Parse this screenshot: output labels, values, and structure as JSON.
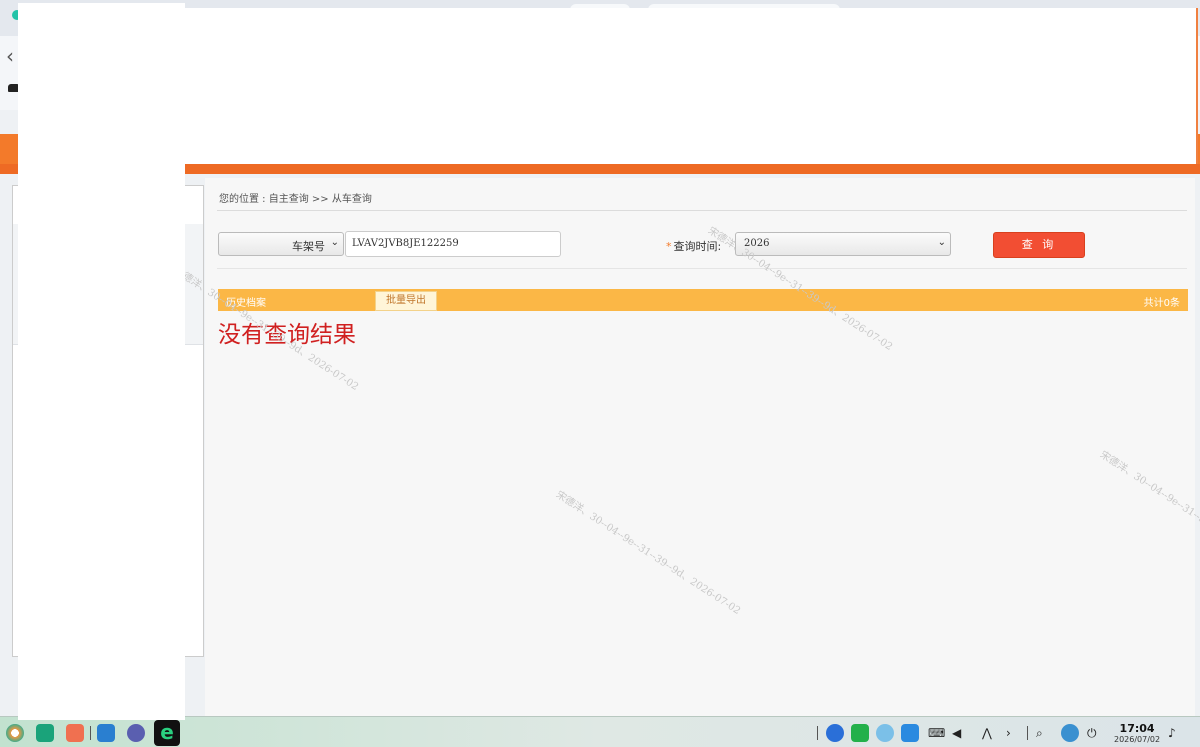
{
  "breadcrumb": "您的位置 : 自主查询 >> 从车查询",
  "search": {
    "field_type": "车架号",
    "vin_value": "LVAV2JVB8JE122259",
    "time_label": "查询时间:",
    "required_mark": "*",
    "year": "2026",
    "query_button": "查 询"
  },
  "results": {
    "section_title": "历史档案",
    "export_button": "批量导出",
    "count_text": "共计0条",
    "empty_message": "没有查询结果"
  },
  "watermark": "宋德洋、30--04--9e--31--39--9d、2026-07-02",
  "taskbar": {
    "time": "17:04",
    "date": "2026/07/02"
  },
  "colors": {
    "accent_orange": "#f37a2a",
    "query_button": "#f24e33",
    "result_bar": "#fbb746",
    "empty_message": "#d02020"
  }
}
